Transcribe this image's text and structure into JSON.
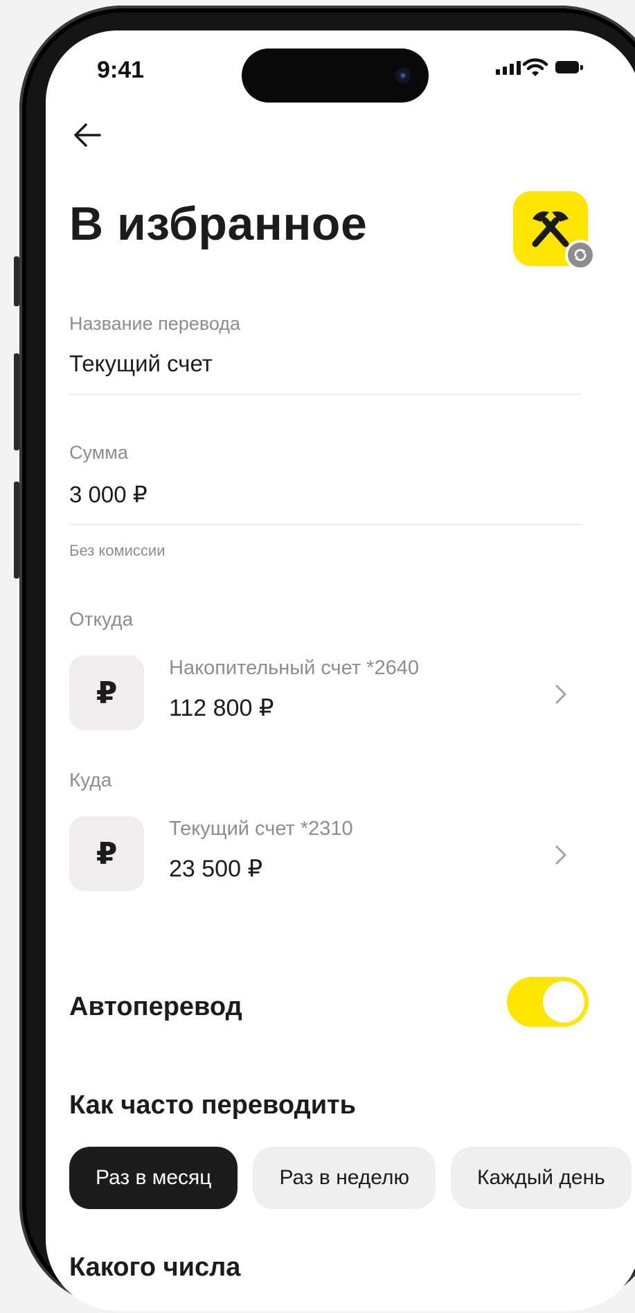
{
  "status_bar": {
    "time": "9:41"
  },
  "header": {
    "title": "В избранное"
  },
  "form": {
    "transfer_name": {
      "label": "Название перевода",
      "value": "Текущий счет"
    },
    "amount": {
      "label": "Сумма",
      "value": "3 000 ₽",
      "hint": "Без комиссии"
    }
  },
  "from": {
    "label": "Откуда",
    "account": {
      "icon": "ruble-icon",
      "icon_glyph": "₽",
      "name": "Накопительный счет *2640",
      "balance": "112 800 ₽"
    }
  },
  "to": {
    "label": "Куда",
    "account": {
      "icon": "ruble-icon",
      "icon_glyph": "₽",
      "name": "Текущий счет *2310",
      "balance": "23 500 ₽"
    }
  },
  "autotransfer": {
    "label": "Автоперевод",
    "enabled": true
  },
  "frequency": {
    "title": "Как часто переводить",
    "options": [
      "Раз в месяц",
      "Раз в неделю",
      "Каждый день"
    ],
    "selected": "Раз в месяц"
  },
  "day": {
    "title": "Какого числа"
  },
  "colors": {
    "accent": "#ffe600",
    "text": "#1c1c1c",
    "muted": "#8d8d8d",
    "chip_bg": "#f0efef",
    "chip_active": "#1c1c1c"
  }
}
